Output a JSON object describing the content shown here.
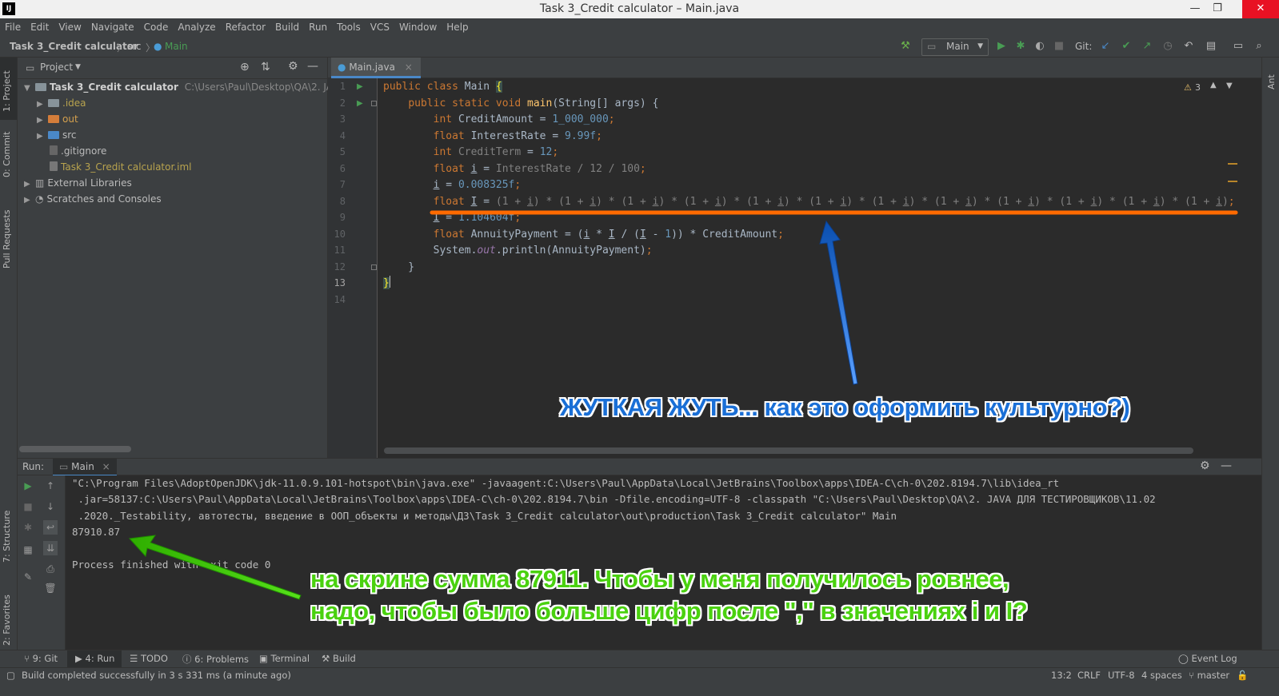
{
  "window": {
    "title": "Task 3_Credit calculator – Main.java",
    "logo": "IJ",
    "minimize": "—",
    "restore": "❐",
    "close": "✕"
  },
  "menu": [
    "File",
    "Edit",
    "View",
    "Navigate",
    "Code",
    "Analyze",
    "Refactor",
    "Build",
    "Run",
    "Tools",
    "VCS",
    "Window",
    "Help"
  ],
  "breadcrumb": {
    "project": "Task 3_Credit calculator",
    "sep": "〉",
    "folder": "src",
    "file": "Main"
  },
  "toolbar": {
    "run_config": "Main",
    "git_label": "Git:"
  },
  "left_stripe": {
    "project": "1: Project",
    "commit": "0: Commit",
    "pull_requests": "Pull Requests",
    "structure": "7: Structure",
    "favorites": "2: Favorites"
  },
  "right_stripe": {
    "ant": "Ant"
  },
  "project_panel": {
    "title": "Project",
    "root_name": "Task 3_Credit calculator",
    "root_path": "C:\\Users\\Paul\\Desktop\\QA\\2. JAVA ДЛЯ",
    "items": [
      {
        "label": ".idea"
      },
      {
        "label": "out"
      },
      {
        "label": "src"
      },
      {
        "label": ".gitignore"
      },
      {
        "label": "Task 3_Credit calculator.iml"
      },
      {
        "label": "External Libraries"
      },
      {
        "label": "Scratches and Consoles"
      }
    ]
  },
  "editor": {
    "tab_label": "Main.java",
    "warnings_count": "3",
    "line_numbers": [
      "1",
      "2",
      "3",
      "4",
      "5",
      "6",
      "7",
      "8",
      "9",
      "10",
      "11",
      "12",
      "13",
      "14"
    ]
  },
  "run_panel": {
    "label": "Run:",
    "tab": "Main",
    "console": [
      "\"C:\\Program Files\\AdoptOpenJDK\\jdk-11.0.9.101-hotspot\\bin\\java.exe\" -javaagent:C:\\Users\\Paul\\AppData\\Local\\JetBrains\\Toolbox\\apps\\IDEA-C\\ch-0\\202.8194.7\\lib\\idea_rt",
      " .jar=58137:C:\\Users\\Paul\\AppData\\Local\\JetBrains\\Toolbox\\apps\\IDEA-C\\ch-0\\202.8194.7\\bin -Dfile.encoding=UTF-8 -classpath \"C:\\Users\\Paul\\Desktop\\QA\\2. JAVA ДЛЯ ТЕСТИРОВЩИКОВ\\11.02",
      " .2020._Testability, автотесты, введение в ООП_объекты и методы\\ДЗ\\Task 3_Credit calculator\\out\\production\\Task 3_Credit calculator\" Main",
      "87910.87",
      "",
      "Process finished with exit code 0"
    ]
  },
  "bottom_tabs": [
    "9: Git",
    "4: Run",
    "TODO",
    "6: Problems",
    "Terminal",
    "Build"
  ],
  "event_log": "Event Log",
  "status": {
    "message": "Build completed successfully in 3 s 331 ms (a minute ago)",
    "position": "13:2",
    "line_sep": "CRLF",
    "encoding": "UTF-8",
    "indent": "4 spaces",
    "branch": "master"
  },
  "annotations": {
    "top": "ЖУТКАЯ ЖУТЬ... как это оформить культурно?)",
    "bottom_line1": "на скрине сумма 87911. Чтобы у меня получилось ровнее,",
    "bottom_line2": "надо, чтобы было  больше цифр после \",\" в значениях i и I?"
  },
  "colors": {
    "underline_orange": "#ff6a00",
    "arrow_blue": "#1a6fd6",
    "arrow_green": "#4ad10f"
  }
}
